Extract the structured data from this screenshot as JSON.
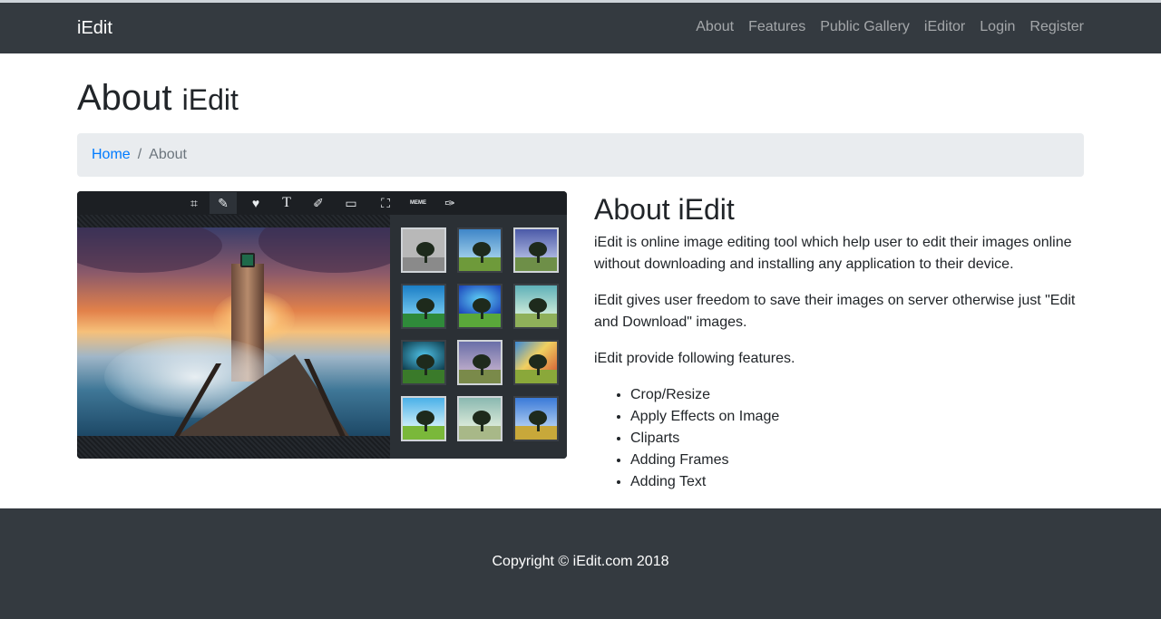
{
  "navbar": {
    "brand": "iEdit",
    "links": [
      "About",
      "Features",
      "Public Gallery",
      "iEditor",
      "Login",
      "Register"
    ]
  },
  "header": {
    "title": "About",
    "subtitle": "iEdit"
  },
  "breadcrumb": {
    "home": "Home",
    "separator": "/",
    "current": "About"
  },
  "editor_preview": {
    "tools": [
      "crop-icon",
      "magic-wand-icon",
      "heart-icon",
      "text-icon",
      "brush-icon",
      "frame-icon",
      "photo-icon",
      "meme-icon",
      "paint-brush-icon"
    ],
    "tool_glyphs": [
      "⌗",
      "✎",
      "♥",
      "T",
      "✐",
      "▭",
      "⛶",
      "MEME",
      "✑"
    ],
    "meme_label": "MEME",
    "filters_count": 12
  },
  "about": {
    "title": "About iEdit",
    "paragraphs": [
      "iEdit is online image editing tool which help user to edit their images online without downloading and installing any application to their device.",
      "iEdit gives user freedom to save their images on server otherwise just \"Edit and Download\" images.",
      "iEdit provide following features."
    ],
    "features": [
      "Crop/Resize",
      "Apply Effects on Image",
      "Cliparts",
      "Adding Frames",
      "Adding Text"
    ]
  },
  "footer": {
    "copyright": "Copyright © iEdit.com 2018"
  },
  "colors": {
    "navbar_bg": "#343a40",
    "link_blue": "#007bff",
    "breadcrumb_bg": "#e9ecef",
    "editor_bg": "#212529"
  }
}
